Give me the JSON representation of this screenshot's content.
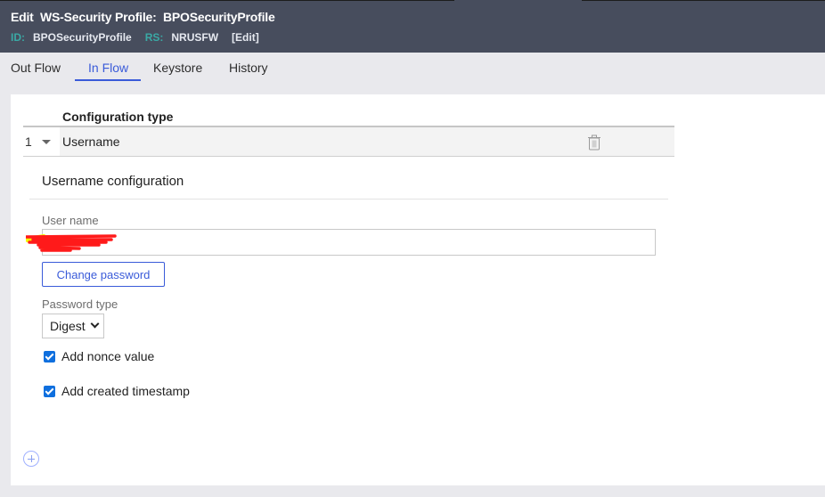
{
  "header": {
    "title": "Edit  WS-Security Profile:  BPOSecurityProfile",
    "id_label": "ID:",
    "id_value": "BPOSecurityProfile",
    "rs_label": "RS:",
    "rs_value": "NRUSFW",
    "edit_link": "[Edit]"
  },
  "tabs": [
    {
      "label": "Out Flow",
      "active": false
    },
    {
      "label": "In Flow",
      "active": true
    },
    {
      "label": "Keystore",
      "active": false
    },
    {
      "label": "History",
      "active": false
    }
  ],
  "table": {
    "column_header": "Configuration type",
    "rows": [
      {
        "index": "1",
        "value": "Username"
      }
    ]
  },
  "section": {
    "title": "Username configuration",
    "username_label": "User name",
    "username_value": "",
    "username_redacted": true,
    "change_password_label": "Change password",
    "password_type_label": "Password type",
    "password_type_value": "Digest",
    "checkboxes": [
      {
        "label": "Add nonce value",
        "checked": true
      },
      {
        "label": "Add created timestamp",
        "checked": true
      }
    ]
  },
  "icons": {
    "row_toggle": "caret-down-icon",
    "delete": "trash-icon",
    "add": "plus-circle-icon"
  },
  "colors": {
    "header_bg": "#474d5d",
    "accent": "#3a5bd9",
    "meta_key": "#3aa9a5",
    "checkbox": "#0f6fde"
  }
}
